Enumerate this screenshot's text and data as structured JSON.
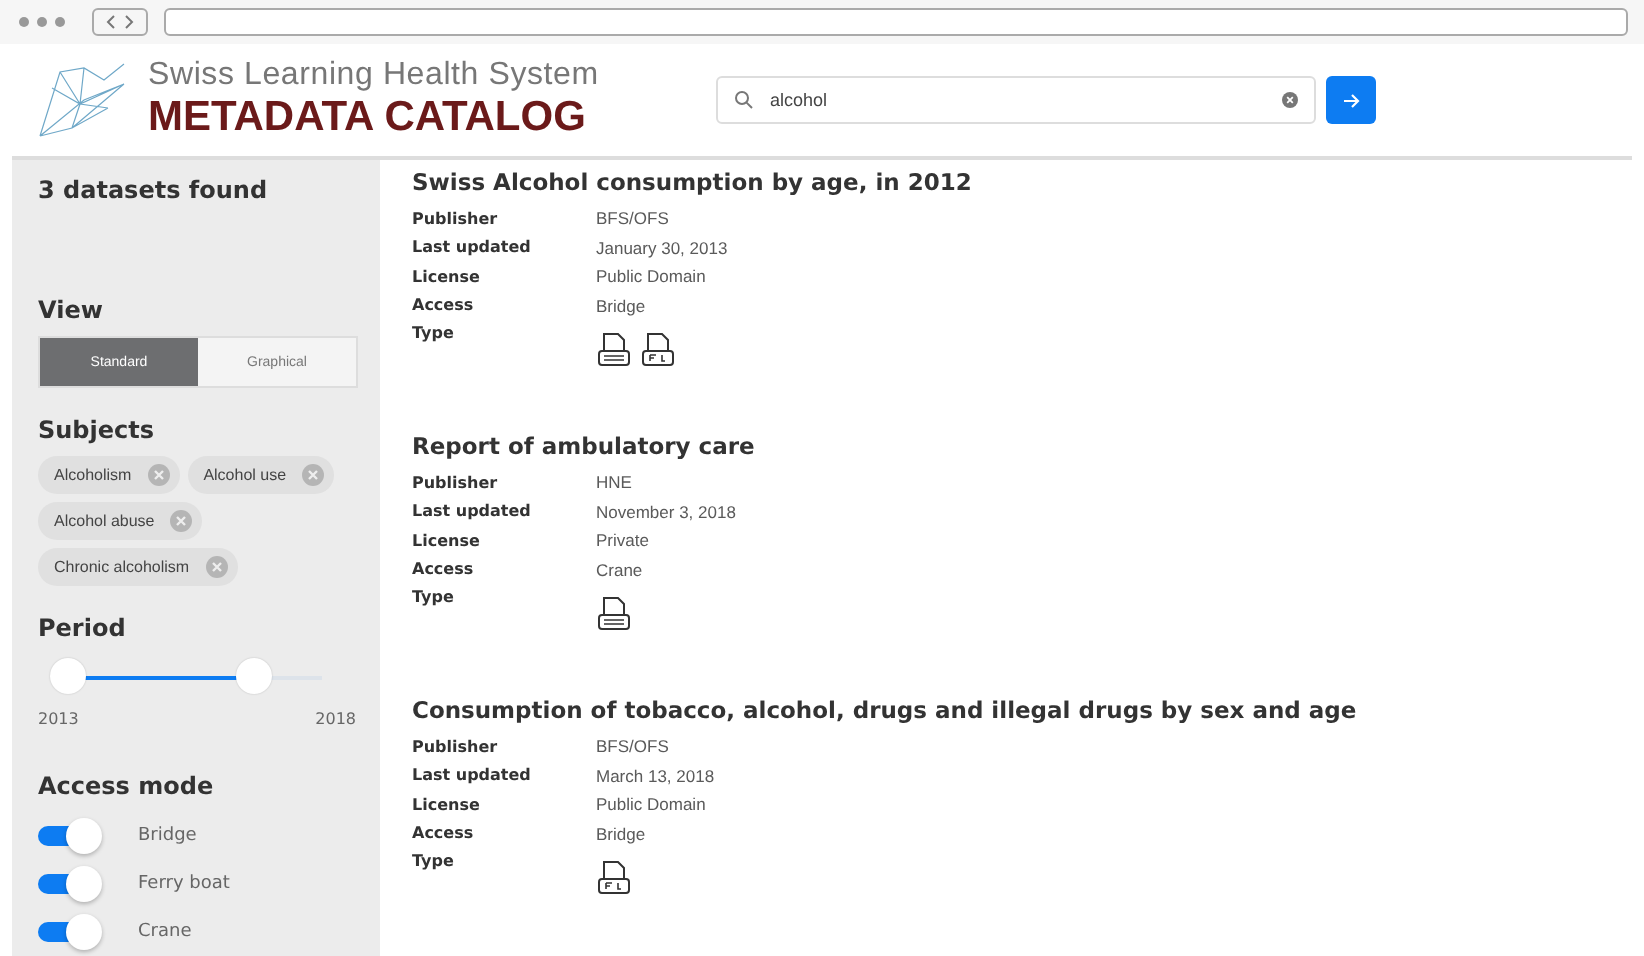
{
  "header": {
    "brand_line": "Swiss Learning Health System",
    "brand_title": "METADATA CATALOG",
    "search": {
      "value": "alcohol"
    }
  },
  "sidebar": {
    "results_count": "3 datasets found",
    "view": {
      "title": "View",
      "options": [
        {
          "label": "Standard",
          "selected": true
        },
        {
          "label": "Graphical",
          "selected": false
        }
      ]
    },
    "subjects": {
      "title": "Subjects",
      "tags": [
        {
          "label": "Alcoholism"
        },
        {
          "label": "Alcohol use"
        },
        {
          "label": "Alcohol abuse"
        },
        {
          "label": "Chronic alcoholism"
        }
      ]
    },
    "period": {
      "title": "Period",
      "level": 0.73,
      "min_label": "2013",
      "max_label": "2018"
    },
    "access_mode": {
      "title": "Access mode",
      "items": [
        {
          "label": "Bridge",
          "on": true
        },
        {
          "label": "Ferry boat",
          "on": true
        },
        {
          "label": "Crane",
          "on": true
        }
      ]
    }
  },
  "datasets": [
    {
      "title": "Swiss Alcohol consumption by age, in 2012",
      "fields": [
        {
          "label": "Publisher",
          "value": "BFS/OFS"
        },
        {
          "label": "Last updated",
          "value": "January 30, 2013"
        },
        {
          "label": "License",
          "value": "Public Domain"
        },
        {
          "label": "Access",
          "value": "Bridge"
        }
      ],
      "type_label": "Type",
      "types": [
        {
          "kind": "csv"
        },
        {
          "kind": "pdf"
        }
      ]
    },
    {
      "title": "Report of ambulatory care",
      "fields": [
        {
          "label": "Publisher",
          "value": "HNE"
        },
        {
          "label": "Last updated",
          "value": "November 3, 2018"
        },
        {
          "label": "License",
          "value": "Private"
        },
        {
          "label": "Access",
          "value": "Crane"
        }
      ],
      "type_label": "Type",
      "types": [
        {
          "kind": "csv"
        }
      ]
    },
    {
      "title": "Consumption of tobacco, alcohol, drugs and illegal drugs by sex and age",
      "fields": [
        {
          "label": "Publisher",
          "value": "BFS/OFS"
        },
        {
          "label": "Last updated",
          "value": "March 13, 2018"
        },
        {
          "label": "License",
          "value": "Public Domain"
        },
        {
          "label": "Access",
          "value": "Bridge"
        }
      ],
      "type_label": "Type",
      "types": [
        {
          "kind": "pdf"
        }
      ]
    }
  ]
}
